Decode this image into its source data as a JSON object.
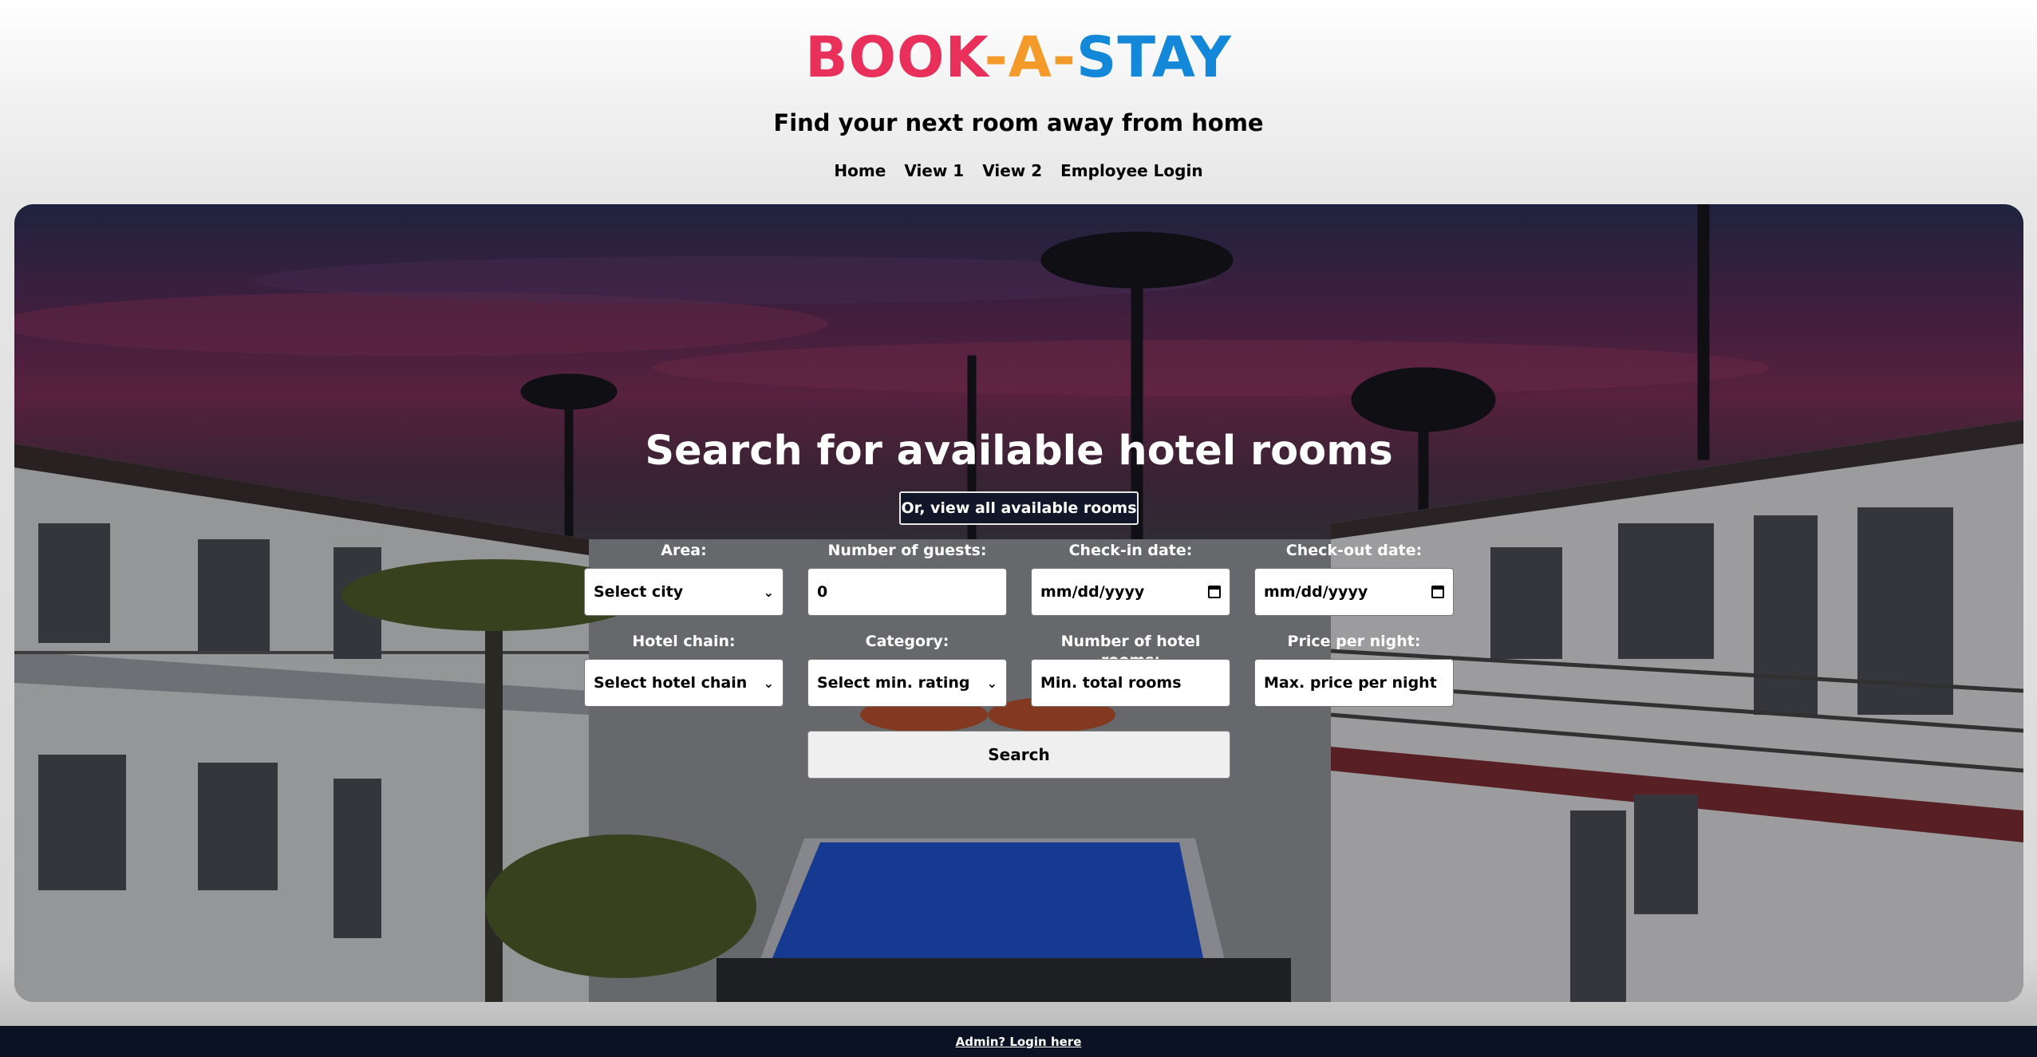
{
  "header": {
    "logo": {
      "part1": "BOOK",
      "dash1": "-",
      "part2": "A",
      "dash2": "-",
      "part3": "STAY"
    },
    "tagline": "Find your next room away from home",
    "nav": [
      "Home",
      "View 1",
      "View 2",
      "Employee Login"
    ]
  },
  "search": {
    "title": "Search for available hotel rooms",
    "view_all_label": "Or, view all available rooms",
    "fields": {
      "area": {
        "label": "Area:",
        "value": "Select city",
        "icon": "chevron-down-icon"
      },
      "guests": {
        "label": "Number of guests:",
        "value": "0"
      },
      "checkin": {
        "label": "Check-in date:",
        "value": "mm/dd/yyyy",
        "icon": "calendar-icon"
      },
      "checkout": {
        "label": "Check-out date:",
        "value": "mm/dd/yyyy",
        "icon": "calendar-icon"
      },
      "chain": {
        "label": "Hotel chain:",
        "value": "Select hotel chain",
        "icon": "chevron-down-icon"
      },
      "category": {
        "label": "Category:",
        "value": "Select min. rating",
        "icon": "chevron-down-icon"
      },
      "rooms": {
        "label": "Number of hotel rooms:",
        "placeholder": "Min. total rooms"
      },
      "price": {
        "label": "Price per night:",
        "placeholder": "Max. price per night"
      }
    },
    "search_label": "Search"
  },
  "footer": {
    "admin_link": "Admin? Login here"
  },
  "colors": {
    "logo_red": "#e8305a",
    "logo_orange": "#f39a2a",
    "logo_blue": "#1488d8",
    "footer_bg": "#0b1223"
  }
}
